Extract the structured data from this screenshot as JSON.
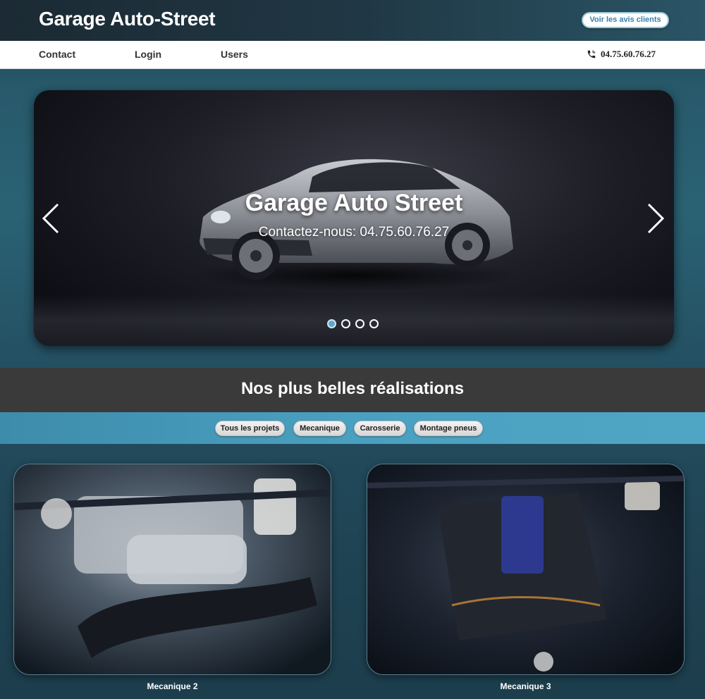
{
  "header": {
    "site_title": "Garage Auto-Street",
    "reviews_button": "Voir les avis clients"
  },
  "nav": {
    "items": [
      {
        "label": "Contact"
      },
      {
        "label": "Login"
      },
      {
        "label": "Users"
      }
    ],
    "phone": "04.75.60.76.27",
    "phone_icon": "phone-icon"
  },
  "carousel": {
    "title": "Garage Auto Street",
    "subtitle": "Contactez-nous: 04.75.60.76.27",
    "slide_count": 4,
    "active_slide": 1,
    "prev_icon": "chevron-left-icon",
    "next_icon": "chevron-right-icon"
  },
  "section": {
    "title": "Nos plus belles réalisations"
  },
  "filters": [
    {
      "label": "Tous les projets"
    },
    {
      "label": "Mecanique"
    },
    {
      "label": "Carosserie"
    },
    {
      "label": "Montage pneus"
    }
  ],
  "projects": [
    {
      "caption": "Mecanique 2"
    },
    {
      "caption": "Mecanique 3"
    }
  ],
  "colors": {
    "accent": "#4aa0c0",
    "header_bg": "#1b2a33",
    "band_dark": "#3a3a3a"
  }
}
